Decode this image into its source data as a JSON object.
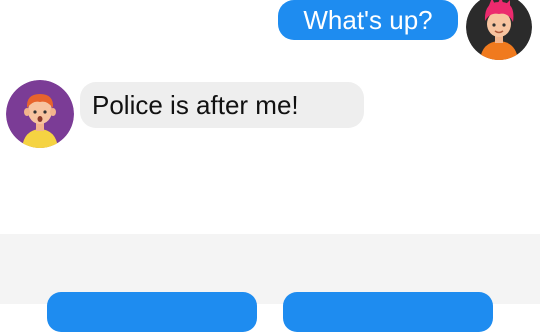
{
  "conversation": {
    "messages": [
      {
        "sender": "user",
        "text": "What's up?",
        "avatar": "pink-haired-person-avatar"
      },
      {
        "sender": "contact",
        "text": "Police is after me!",
        "avatar": "red-haired-person-avatar"
      }
    ]
  },
  "reply_options": [
    {
      "label": ""
    },
    {
      "label": ""
    }
  ],
  "colors": {
    "outgoing_bubble": "#1e8cf0",
    "incoming_bubble": "#eeeeee",
    "panel": "#f4f4f4",
    "user_avatar_bg": "#2b2b2b",
    "contact_avatar_bg": "#7b3c96"
  }
}
